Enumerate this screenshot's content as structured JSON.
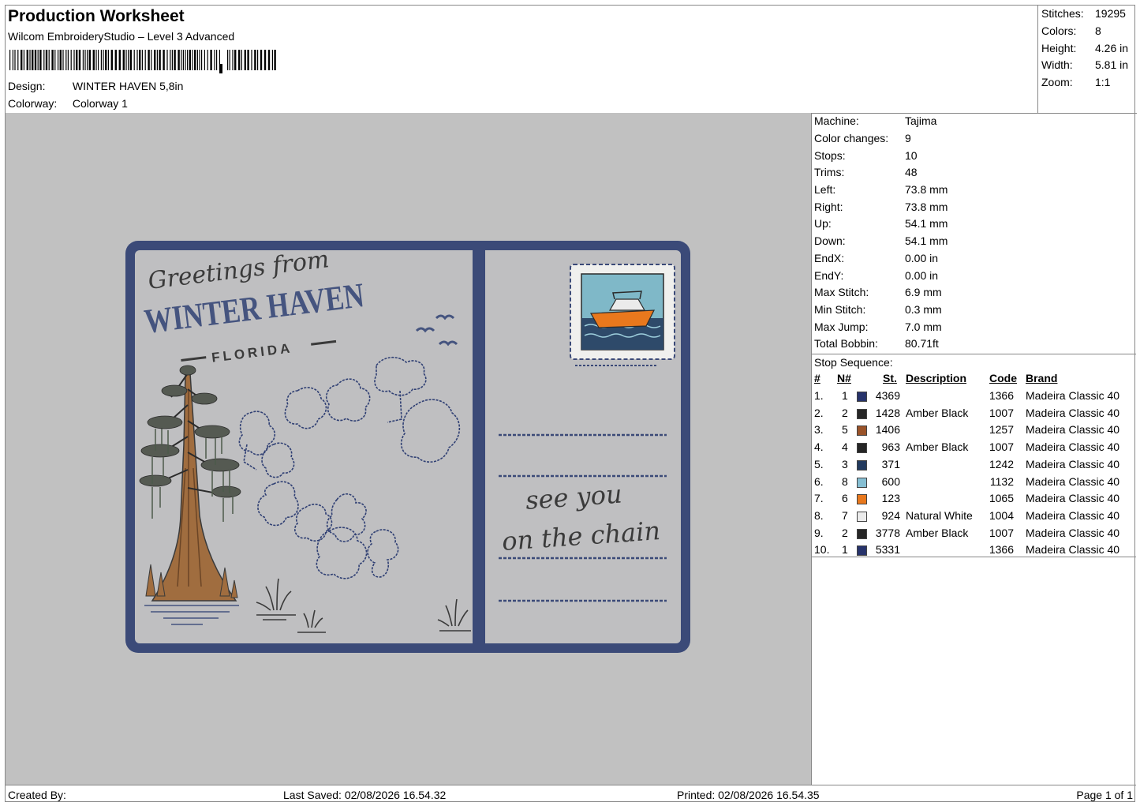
{
  "header": {
    "title": "Production Worksheet",
    "software": "Wilcom EmbroideryStudio – Level 3 Advanced",
    "design_label": "Design:",
    "design_value": "WINTER HAVEN 5,8in",
    "colorway_label": "Colorway:",
    "colorway_value": "Colorway 1"
  },
  "summary": [
    {
      "label": "Stitches:",
      "value": "19295"
    },
    {
      "label": "Colors:",
      "value": "8"
    },
    {
      "label": "Height:",
      "value": "4.26 in"
    },
    {
      "label": "Width:",
      "value": "5.81 in"
    },
    {
      "label": "Zoom:",
      "value": "1:1"
    }
  ],
  "machine_info": [
    {
      "label": "Machine:",
      "value": "Tajima"
    },
    {
      "label": "Color changes:",
      "value": "9"
    },
    {
      "label": "Stops:",
      "value": "10"
    },
    {
      "label": "Trims:",
      "value": "48"
    },
    {
      "label": "Left:",
      "value": "73.8 mm"
    },
    {
      "label": "Right:",
      "value": "73.8 mm"
    },
    {
      "label": "Up:",
      "value": "54.1 mm"
    },
    {
      "label": "Down:",
      "value": "54.1 mm"
    },
    {
      "label": "EndX:",
      "value": "0.00 in"
    },
    {
      "label": "EndY:",
      "value": "0.00 in"
    },
    {
      "label": "Max Stitch:",
      "value": "6.9 mm"
    },
    {
      "label": "Min Stitch:",
      "value": "0.3 mm"
    },
    {
      "label": "Max Jump:",
      "value": "7.0 mm"
    },
    {
      "label": "Total Bobbin:",
      "value": "80.71ft"
    }
  ],
  "stop_sequence": {
    "title": "Stop Sequence:",
    "columns": {
      "num": "#",
      "needle": "N#",
      "stitches": "St.",
      "description": "Description",
      "code": "Code",
      "brand": "Brand"
    },
    "rows": [
      {
        "num": "1.",
        "needle": "1",
        "color": "#27336b",
        "stitches": "4369",
        "description": "",
        "code": "1366",
        "brand": "Madeira Classic 40"
      },
      {
        "num": "2.",
        "needle": "2",
        "color": "#262626",
        "stitches": "1428",
        "description": "Amber Black",
        "code": "1007",
        "brand": "Madeira Classic 40"
      },
      {
        "num": "3.",
        "needle": "5",
        "color": "#9a5329",
        "stitches": "1406",
        "description": "",
        "code": "1257",
        "brand": "Madeira Classic 40"
      },
      {
        "num": "4.",
        "needle": "4",
        "color": "#262626",
        "stitches": "963",
        "description": "Amber Black",
        "code": "1007",
        "brand": "Madeira Classic 40"
      },
      {
        "num": "5.",
        "needle": "3",
        "color": "#223a5e",
        "stitches": "371",
        "description": "",
        "code": "1242",
        "brand": "Madeira Classic 40"
      },
      {
        "num": "6.",
        "needle": "8",
        "color": "#86bfd3",
        "stitches": "600",
        "description": "",
        "code": "1132",
        "brand": "Madeira Classic 40"
      },
      {
        "num": "7.",
        "needle": "6",
        "color": "#e8781d",
        "stitches": "123",
        "description": "",
        "code": "1065",
        "brand": "Madeira Classic 40"
      },
      {
        "num": "8.",
        "needle": "7",
        "color": "#ebebeb",
        "stitches": "924",
        "description": "Natural White",
        "code": "1004",
        "brand": "Madeira Classic 40"
      },
      {
        "num": "9.",
        "needle": "2",
        "color": "#262626",
        "stitches": "3778",
        "description": "Amber Black",
        "code": "1007",
        "brand": "Madeira Classic 40"
      },
      {
        "num": "10.",
        "needle": "1",
        "color": "#27336b",
        "stitches": "5331",
        "description": "",
        "code": "1366",
        "brand": "Madeira Classic 40"
      }
    ]
  },
  "design_preview": {
    "greeting": "Greetings from",
    "city": "WINTER HAVEN",
    "state": "FLORIDA",
    "message_line1": "see you",
    "message_line2": "on the chain",
    "colors": {
      "border": "#3b4a78",
      "fabric": "#bfbfc1",
      "text_blue": "#45547f",
      "text_dark": "#3a3a3a",
      "trunk": "#a06d3f"
    }
  },
  "footer": {
    "created_by": "Created By:",
    "last_saved": "Last Saved: 02/08/2026 16.54.32",
    "printed": "Printed: 02/08/2026 16.54.35",
    "page": "Page 1 of 1"
  }
}
